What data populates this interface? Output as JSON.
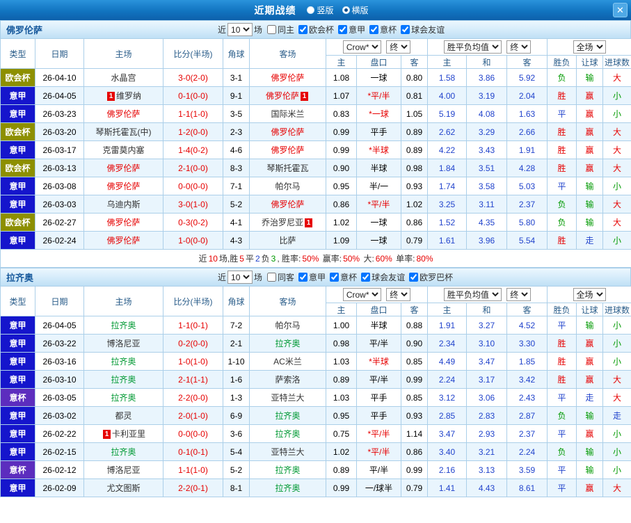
{
  "topbar": {
    "title": "近期战绩",
    "vertical_label": "竖版",
    "horizontal_label": "横版",
    "horizontal_selected": true,
    "close_icon": "✕"
  },
  "columns": {
    "type": "类型",
    "date": "日期",
    "home": "主场",
    "score": "比分(半场)",
    "corners": "角球",
    "away": "客场",
    "odds_home": "主",
    "handicap": "盘口",
    "odds_away": "客",
    "avg_home": "主",
    "avg_draw": "和",
    "avg_away": "客",
    "result": "胜负",
    "handicap_result": "让球",
    "goals": "进球数"
  },
  "league_colors": {
    "欧会杯": "#8d8f00",
    "意甲": "#1515cc",
    "意杯": "#5c2dbe"
  },
  "value_colors": {
    "胜": "#e60000",
    "平": "#2244cc",
    "负": "#009900",
    "赢": "#e60000",
    "走": "#2244cc",
    "输": "#009900",
    "大": "#e60000",
    "小": "#009900"
  },
  "sections": [
    {
      "team": "佛罗伦萨",
      "team_color": "#e60000",
      "near_label": "近",
      "games": "10",
      "games_suffix": "场",
      "filters": [
        {
          "label": "同主",
          "checked": false
        },
        {
          "label": "欧会杯",
          "checked": true
        },
        {
          "label": "意甲",
          "checked": true
        },
        {
          "label": "意杯",
          "checked": true
        },
        {
          "label": "球会友谊",
          "checked": true
        }
      ],
      "selects": {
        "source": "Crow*",
        "state1": "终",
        "avg": "胜平负均值",
        "state2": "终",
        "scope": "全场"
      },
      "rows": [
        {
          "league": "欧会杯",
          "date": "26-04-10",
          "home": "水晶宫",
          "home_hl": false,
          "home_badge": "",
          "score": "3-0(2-0)",
          "corners": "3-1",
          "away": "佛罗伦萨",
          "away_hl": true,
          "away_badge": "",
          "odds_home": "1.08",
          "handicap": "一球",
          "handicap_red": false,
          "odds_away": "0.80",
          "avg_home": "1.58",
          "avg_draw": "3.86",
          "avg_away": "5.92",
          "result": "负",
          "handicap_result": "输",
          "goals": "大"
        },
        {
          "league": "意甲",
          "date": "26-04-05",
          "home": "维罗纳",
          "home_hl": false,
          "home_badge": "1",
          "score": "0-1(0-0)",
          "corners": "9-1",
          "away": "佛罗伦萨",
          "away_hl": true,
          "away_badge": "1",
          "odds_home": "1.07",
          "handicap": "*平/半",
          "handicap_red": true,
          "odds_away": "0.81",
          "avg_home": "4.00",
          "avg_draw": "3.19",
          "avg_away": "2.04",
          "result": "胜",
          "handicap_result": "赢",
          "goals": "小"
        },
        {
          "league": "意甲",
          "date": "26-03-23",
          "home": "佛罗伦萨",
          "home_hl": true,
          "home_badge": "",
          "score": "1-1(1-0)",
          "corners": "3-5",
          "away": "国际米兰",
          "away_hl": false,
          "away_badge": "",
          "odds_home": "0.83",
          "handicap": "*一球",
          "handicap_red": true,
          "odds_away": "1.05",
          "avg_home": "5.19",
          "avg_draw": "4.08",
          "avg_away": "1.63",
          "result": "平",
          "handicap_result": "赢",
          "goals": "小"
        },
        {
          "league": "欧会杯",
          "date": "26-03-20",
          "home": "琴斯托霍瓦(中)",
          "home_hl": false,
          "home_badge": "",
          "score": "1-2(0-0)",
          "corners": "2-3",
          "away": "佛罗伦萨",
          "away_hl": true,
          "away_badge": "",
          "odds_home": "0.99",
          "handicap": "平手",
          "handicap_red": false,
          "odds_away": "0.89",
          "avg_home": "2.62",
          "avg_draw": "3.29",
          "avg_away": "2.66",
          "result": "胜",
          "handicap_result": "赢",
          "goals": "大"
        },
        {
          "league": "意甲",
          "date": "26-03-17",
          "home": "克雷莫内塞",
          "home_hl": false,
          "home_badge": "",
          "score": "1-4(0-2)",
          "corners": "4-6",
          "away": "佛罗伦萨",
          "away_hl": true,
          "away_badge": "",
          "odds_home": "0.99",
          "handicap": "*半球",
          "handicap_red": true,
          "odds_away": "0.89",
          "avg_home": "4.22",
          "avg_draw": "3.43",
          "avg_away": "1.91",
          "result": "胜",
          "handicap_result": "赢",
          "goals": "大"
        },
        {
          "league": "欧会杯",
          "date": "26-03-13",
          "home": "佛罗伦萨",
          "home_hl": true,
          "home_badge": "",
          "score": "2-1(0-0)",
          "corners": "8-3",
          "away": "琴斯托霍瓦",
          "away_hl": false,
          "away_badge": "",
          "odds_home": "0.90",
          "handicap": "半球",
          "handicap_red": false,
          "odds_away": "0.98",
          "avg_home": "1.84",
          "avg_draw": "3.51",
          "avg_away": "4.28",
          "result": "胜",
          "handicap_result": "赢",
          "goals": "大"
        },
        {
          "league": "意甲",
          "date": "26-03-08",
          "home": "佛罗伦萨",
          "home_hl": true,
          "home_badge": "",
          "score": "0-0(0-0)",
          "corners": "7-1",
          "away": "帕尔马",
          "away_hl": false,
          "away_badge": "",
          "odds_home": "0.95",
          "handicap": "半/一",
          "handicap_red": false,
          "odds_away": "0.93",
          "avg_home": "1.74",
          "avg_draw": "3.58",
          "avg_away": "5.03",
          "result": "平",
          "handicap_result": "输",
          "goals": "小"
        },
        {
          "league": "意甲",
          "date": "26-03-03",
          "home": "乌迪内斯",
          "home_hl": false,
          "home_badge": "",
          "score": "3-0(1-0)",
          "corners": "5-2",
          "away": "佛罗伦萨",
          "away_hl": true,
          "away_badge": "",
          "odds_home": "0.86",
          "handicap": "*平/半",
          "handicap_red": true,
          "odds_away": "1.02",
          "avg_home": "3.25",
          "avg_draw": "3.11",
          "avg_away": "2.37",
          "result": "负",
          "handicap_result": "输",
          "goals": "大"
        },
        {
          "league": "欧会杯",
          "date": "26-02-27",
          "home": "佛罗伦萨",
          "home_hl": true,
          "home_badge": "",
          "score": "0-3(0-2)",
          "corners": "4-1",
          "away": "乔治罗尼亚",
          "away_hl": false,
          "away_badge": "1",
          "odds_home": "1.02",
          "handicap": "一球",
          "handicap_red": false,
          "odds_away": "0.86",
          "avg_home": "1.52",
          "avg_draw": "4.35",
          "avg_away": "5.80",
          "result": "负",
          "handicap_result": "输",
          "goals": "大"
        },
        {
          "league": "意甲",
          "date": "26-02-24",
          "home": "佛罗伦萨",
          "home_hl": true,
          "home_badge": "",
          "score": "1-0(0-0)",
          "corners": "4-3",
          "away": "比萨",
          "away_hl": false,
          "away_badge": "",
          "odds_home": "1.09",
          "handicap": "一球",
          "handicap_red": false,
          "odds_away": "0.79",
          "avg_home": "1.61",
          "avg_draw": "3.96",
          "avg_away": "5.54",
          "result": "胜",
          "handicap_result": "走",
          "goals": "小"
        }
      ],
      "summary": [
        {
          "text": "近",
          "color": ""
        },
        {
          "text": "10",
          "color": "#e60000"
        },
        {
          "text": "场,胜",
          "color": ""
        },
        {
          "text": "5",
          "color": "#e60000"
        },
        {
          "text": "平",
          "color": ""
        },
        {
          "text": "2",
          "color": "#2244cc"
        },
        {
          "text": "负",
          "color": ""
        },
        {
          "text": "3",
          "color": "#009900"
        },
        {
          "text": ", 胜率:",
          "color": ""
        },
        {
          "text": "50%",
          "color": "#e60000"
        },
        {
          "text": " 赢率:",
          "color": ""
        },
        {
          "text": "50%",
          "color": "#e60000"
        },
        {
          "text": " 大:",
          "color": ""
        },
        {
          "text": "60%",
          "color": "#e60000"
        },
        {
          "text": " 单率:",
          "color": ""
        },
        {
          "text": "80%",
          "color": "#e60000"
        }
      ]
    },
    {
      "team": "拉齐奥",
      "team_color": "#009933",
      "near_label": "近",
      "games": "10",
      "games_suffix": "场",
      "filters": [
        {
          "label": "同客",
          "checked": false
        },
        {
          "label": "意甲",
          "checked": true
        },
        {
          "label": "意杯",
          "checked": true
        },
        {
          "label": "球会友谊",
          "checked": true
        },
        {
          "label": "欧罗巴杯",
          "checked": true
        }
      ],
      "selects": {
        "source": "Crow*",
        "state1": "终",
        "avg": "胜平负均值",
        "state2": "终",
        "scope": "全场"
      },
      "rows": [
        {
          "league": "意甲",
          "date": "26-04-05",
          "home": "拉齐奥",
          "home_hl": true,
          "home_badge": "",
          "score": "1-1(0-1)",
          "corners": "7-2",
          "away": "帕尔马",
          "away_hl": false,
          "away_badge": "",
          "odds_home": "1.00",
          "handicap": "半球",
          "handicap_red": false,
          "odds_away": "0.88",
          "avg_home": "1.91",
          "avg_draw": "3.27",
          "avg_away": "4.52",
          "result": "平",
          "handicap_result": "输",
          "goals": "小"
        },
        {
          "league": "意甲",
          "date": "26-03-22",
          "home": "博洛尼亚",
          "home_hl": false,
          "home_badge": "",
          "score": "0-2(0-0)",
          "corners": "2-1",
          "away": "拉齐奥",
          "away_hl": true,
          "away_badge": "",
          "odds_home": "0.98",
          "handicap": "平/半",
          "handicap_red": false,
          "odds_away": "0.90",
          "avg_home": "2.34",
          "avg_draw": "3.10",
          "avg_away": "3.30",
          "result": "胜",
          "handicap_result": "赢",
          "goals": "小"
        },
        {
          "league": "意甲",
          "date": "26-03-16",
          "home": "拉齐奥",
          "home_hl": true,
          "home_badge": "",
          "score": "1-0(1-0)",
          "corners": "1-10",
          "away": "AC米兰",
          "away_hl": false,
          "away_badge": "",
          "odds_home": "1.03",
          "handicap": "*半球",
          "handicap_red": true,
          "odds_away": "0.85",
          "avg_home": "4.49",
          "avg_draw": "3.47",
          "avg_away": "1.85",
          "result": "胜",
          "handicap_result": "赢",
          "goals": "小"
        },
        {
          "league": "意甲",
          "date": "26-03-10",
          "home": "拉齐奥",
          "home_hl": true,
          "home_badge": "",
          "score": "2-1(1-1)",
          "corners": "1-6",
          "away": "萨索洛",
          "away_hl": false,
          "away_badge": "",
          "odds_home": "0.89",
          "handicap": "平/半",
          "handicap_red": false,
          "odds_away": "0.99",
          "avg_home": "2.24",
          "avg_draw": "3.17",
          "avg_away": "3.42",
          "result": "胜",
          "handicap_result": "赢",
          "goals": "大"
        },
        {
          "league": "意杯",
          "date": "26-03-05",
          "home": "拉齐奥",
          "home_hl": true,
          "home_badge": "",
          "score": "2-2(0-0)",
          "corners": "1-3",
          "away": "亚特兰大",
          "away_hl": false,
          "away_badge": "",
          "odds_home": "1.03",
          "handicap": "平手",
          "handicap_red": false,
          "odds_away": "0.85",
          "avg_home": "3.12",
          "avg_draw": "3.06",
          "avg_away": "2.43",
          "result": "平",
          "handicap_result": "走",
          "goals": "大"
        },
        {
          "league": "意甲",
          "date": "26-03-02",
          "home": "都灵",
          "home_hl": false,
          "home_badge": "",
          "score": "2-0(1-0)",
          "corners": "6-9",
          "away": "拉齐奥",
          "away_hl": true,
          "away_badge": "",
          "odds_home": "0.95",
          "handicap": "平手",
          "handicap_red": false,
          "odds_away": "0.93",
          "avg_home": "2.85",
          "avg_draw": "2.83",
          "avg_away": "2.87",
          "result": "负",
          "handicap_result": "输",
          "goals": "走"
        },
        {
          "league": "意甲",
          "date": "26-02-22",
          "home": "卡利亚里",
          "home_hl": false,
          "home_badge": "1",
          "score": "0-0(0-0)",
          "corners": "3-6",
          "away": "拉齐奥",
          "away_hl": true,
          "away_badge": "",
          "odds_home": "0.75",
          "handicap": "*平/半",
          "handicap_red": true,
          "odds_away": "1.14",
          "avg_home": "3.47",
          "avg_draw": "2.93",
          "avg_away": "2.37",
          "result": "平",
          "handicap_result": "赢",
          "goals": "小"
        },
        {
          "league": "意甲",
          "date": "26-02-15",
          "home": "拉齐奥",
          "home_hl": true,
          "home_badge": "",
          "score": "0-1(0-1)",
          "corners": "5-4",
          "away": "亚特兰大",
          "away_hl": false,
          "away_badge": "",
          "odds_home": "1.02",
          "handicap": "*平/半",
          "handicap_red": true,
          "odds_away": "0.86",
          "avg_home": "3.40",
          "avg_draw": "3.21",
          "avg_away": "2.24",
          "result": "负",
          "handicap_result": "输",
          "goals": "小"
        },
        {
          "league": "意杯",
          "date": "26-02-12",
          "home": "博洛尼亚",
          "home_hl": false,
          "home_badge": "",
          "score": "1-1(1-0)",
          "corners": "5-2",
          "away": "拉齐奥",
          "away_hl": true,
          "away_badge": "",
          "odds_home": "0.89",
          "handicap": "平/半",
          "handicap_red": false,
          "odds_away": "0.99",
          "avg_home": "2.16",
          "avg_draw": "3.13",
          "avg_away": "3.59",
          "result": "平",
          "handicap_result": "输",
          "goals": "小"
        },
        {
          "league": "意甲",
          "date": "26-02-09",
          "home": "尤文图斯",
          "home_hl": false,
          "home_badge": "",
          "score": "2-2(0-1)",
          "corners": "8-1",
          "away": "拉齐奥",
          "away_hl": true,
          "away_badge": "",
          "odds_home": "0.99",
          "handicap": "一/球半",
          "handicap_red": false,
          "odds_away": "0.79",
          "avg_home": "1.41",
          "avg_draw": "4.43",
          "avg_away": "8.61",
          "result": "平",
          "handicap_result": "赢",
          "goals": "大"
        }
      ],
      "summary": []
    }
  ]
}
